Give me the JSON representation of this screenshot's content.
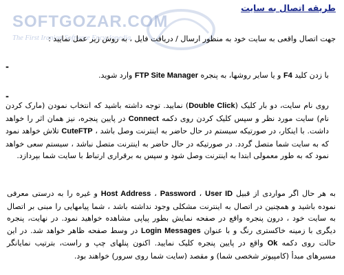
{
  "document": {
    "title": "طريقه اتصال به سايت",
    "watermark": {
      "logo": "SOFTGOZAR.COM",
      "subtitle": "The First Iranian Software Encyclopedia"
    },
    "paragraphs": {
      "intro": "جهت اتصال واقعی به سایت خود به منظور ارسال / دریافت فایل ، به روش زیر عمل نمایید :",
      "step1": {
        "before": "با زدن کلید",
        "key": "F4",
        "middle": "و یا سایر روشها، به پنجره",
        "window": "FTP Site Manager",
        "after": "وارد شوید."
      },
      "step2": {
        "s1": "روی نام سایت، دو بار کلیک (",
        "dbl": "Double Click",
        "s2": ") نمایید. توجه داشته باشید که انتخاب نمودن (مارک کردن نام) سایت مورد نظر و سپس کلیک کردن روی دکمه",
        "connect": "Connect",
        "s3": "در پایین پنجره، نیز همان اثر را خواهد داشت. با اینکار، در صورتیکه سیستم در حال حاضر به اینترنت وصل باشد ،",
        "cuteftp": "CuteFTP",
        "s4": "تلاش خواهد نمود که به سایت شما متصل گردد. در صورتیکه در حال حاضر به اینترنت متصل نباشد ، سیستم سعی خواهد نمود که به طور معمولی ابتدا به اینترنت وصل شود و سپس به برقراری ارتباط با سایت شما بپردازد."
      },
      "step3": {
        "s1": "به هر حال اگر مواردی از قبیل",
        "host": "Host Address",
        "sep1": "،",
        "password": "Password",
        "sep2": "،",
        "userid": "User ID",
        "s2": "و غیره را به درستی معرفی نموده باشید و همچنین در اتصال به اینترنت مشکلی وجود نداشته باشد ، شما پیامهایی را مبنی بر اتصال به سایت خود ، درون پنجره واقع در صفحه نمایش بطور پیاپی مشاهده خواهید نمود. در نهایت، پنجره دیگری با زمینه خاکستری رنگ و با عنوان",
        "login": "Login Messages",
        "s3": "در وسط صفحه ظاهر خواهد شد. در این حالت روی دکمه",
        "ok": "Ok",
        "s4": "واقع در پایین پنجره کلیک نمایید. اکنون پنلهای چپ و راست، بترتیب نمایانگر مسیرهای مبدأ (کامپیوتر شخصی شما) و مقصد (سایت شما روی سرور) خواهند بود."
      }
    },
    "bullets": {
      "b1": "-",
      "b2": "-"
    }
  }
}
